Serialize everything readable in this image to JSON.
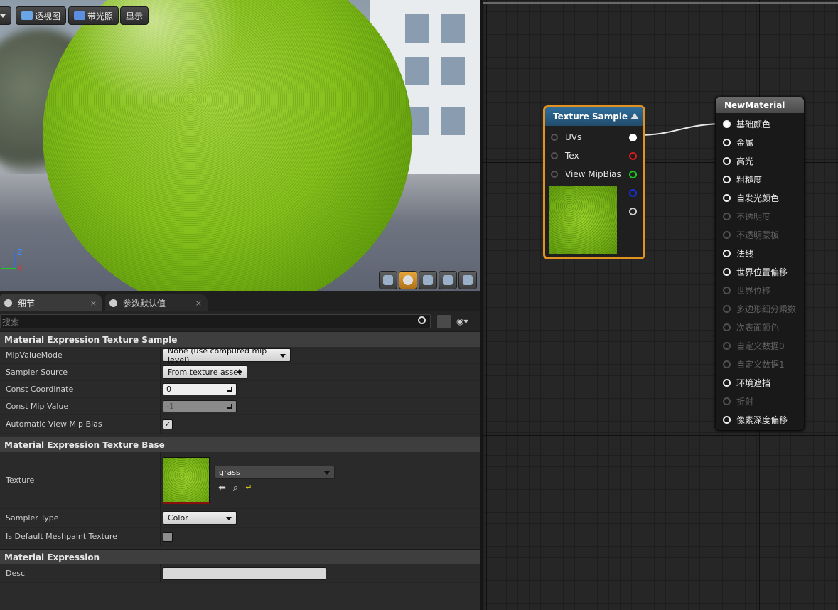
{
  "toolbar": {
    "perspective_label": "透视图",
    "lit_label": "带光照",
    "show_label": "显示"
  },
  "axis": {
    "z": "Z",
    "x": "X"
  },
  "details": {
    "tabs": [
      {
        "label": "细节",
        "close": "×"
      },
      {
        "label": "参数默认值",
        "close": "×"
      }
    ],
    "search_placeholder": "搜索",
    "categories": {
      "texture_sample": {
        "title": "Material Expression Texture Sample",
        "mip_value_mode_label": "MipValueMode",
        "mip_value_mode_value": "None (use computed mip level)",
        "sampler_source_label": "Sampler Source",
        "sampler_source_value": "From texture asset",
        "const_coordinate_label": "Const Coordinate",
        "const_coordinate_value": "0",
        "const_mip_value_label": "Const Mip Value",
        "const_mip_value_value": "-1",
        "auto_view_mip_bias_label": "Automatic View Mip Bias",
        "auto_view_mip_bias_checked": true
      },
      "texture_base": {
        "title": "Material Expression Texture Base",
        "texture_label": "Texture",
        "texture_value": "grass",
        "sampler_type_label": "Sampler Type",
        "sampler_type_value": "Color",
        "default_meshpaint_label": "Is Default Meshpaint Texture",
        "default_meshpaint_checked": false
      },
      "expression": {
        "title": "Material Expression",
        "desc_label": "Desc",
        "desc_value": ""
      }
    }
  },
  "graph": {
    "texture_sample_node": {
      "title": "Texture Sample",
      "inputs": [
        "UVs",
        "Tex",
        "View MipBias"
      ],
      "output_colors": [
        "#ffffff",
        "#e01a1a",
        "#1ec81e",
        "#1a2fe0",
        "#cfcfcf"
      ]
    },
    "material_node": {
      "title": "NewMaterial",
      "pins": [
        {
          "label": "基础颜色",
          "enabled": true,
          "connected": true
        },
        {
          "label": "金属",
          "enabled": true
        },
        {
          "label": "高光",
          "enabled": true
        },
        {
          "label": "粗糙度",
          "enabled": true
        },
        {
          "label": "自发光颜色",
          "enabled": true
        },
        {
          "label": "不透明度",
          "enabled": false
        },
        {
          "label": "不透明蒙板",
          "enabled": false
        },
        {
          "label": "法线",
          "enabled": true
        },
        {
          "label": "世界位置偏移",
          "enabled": true
        },
        {
          "label": "世界位移",
          "enabled": false
        },
        {
          "label": "多边形细分乘数",
          "enabled": false
        },
        {
          "label": "次表面颜色",
          "enabled": false
        },
        {
          "label": "自定义数据0",
          "enabled": false
        },
        {
          "label": "自定义数据1",
          "enabled": false
        },
        {
          "label": "环境遮挡",
          "enabled": true
        },
        {
          "label": "折射",
          "enabled": false
        },
        {
          "label": "像素深度偏移",
          "enabled": true
        }
      ]
    }
  }
}
